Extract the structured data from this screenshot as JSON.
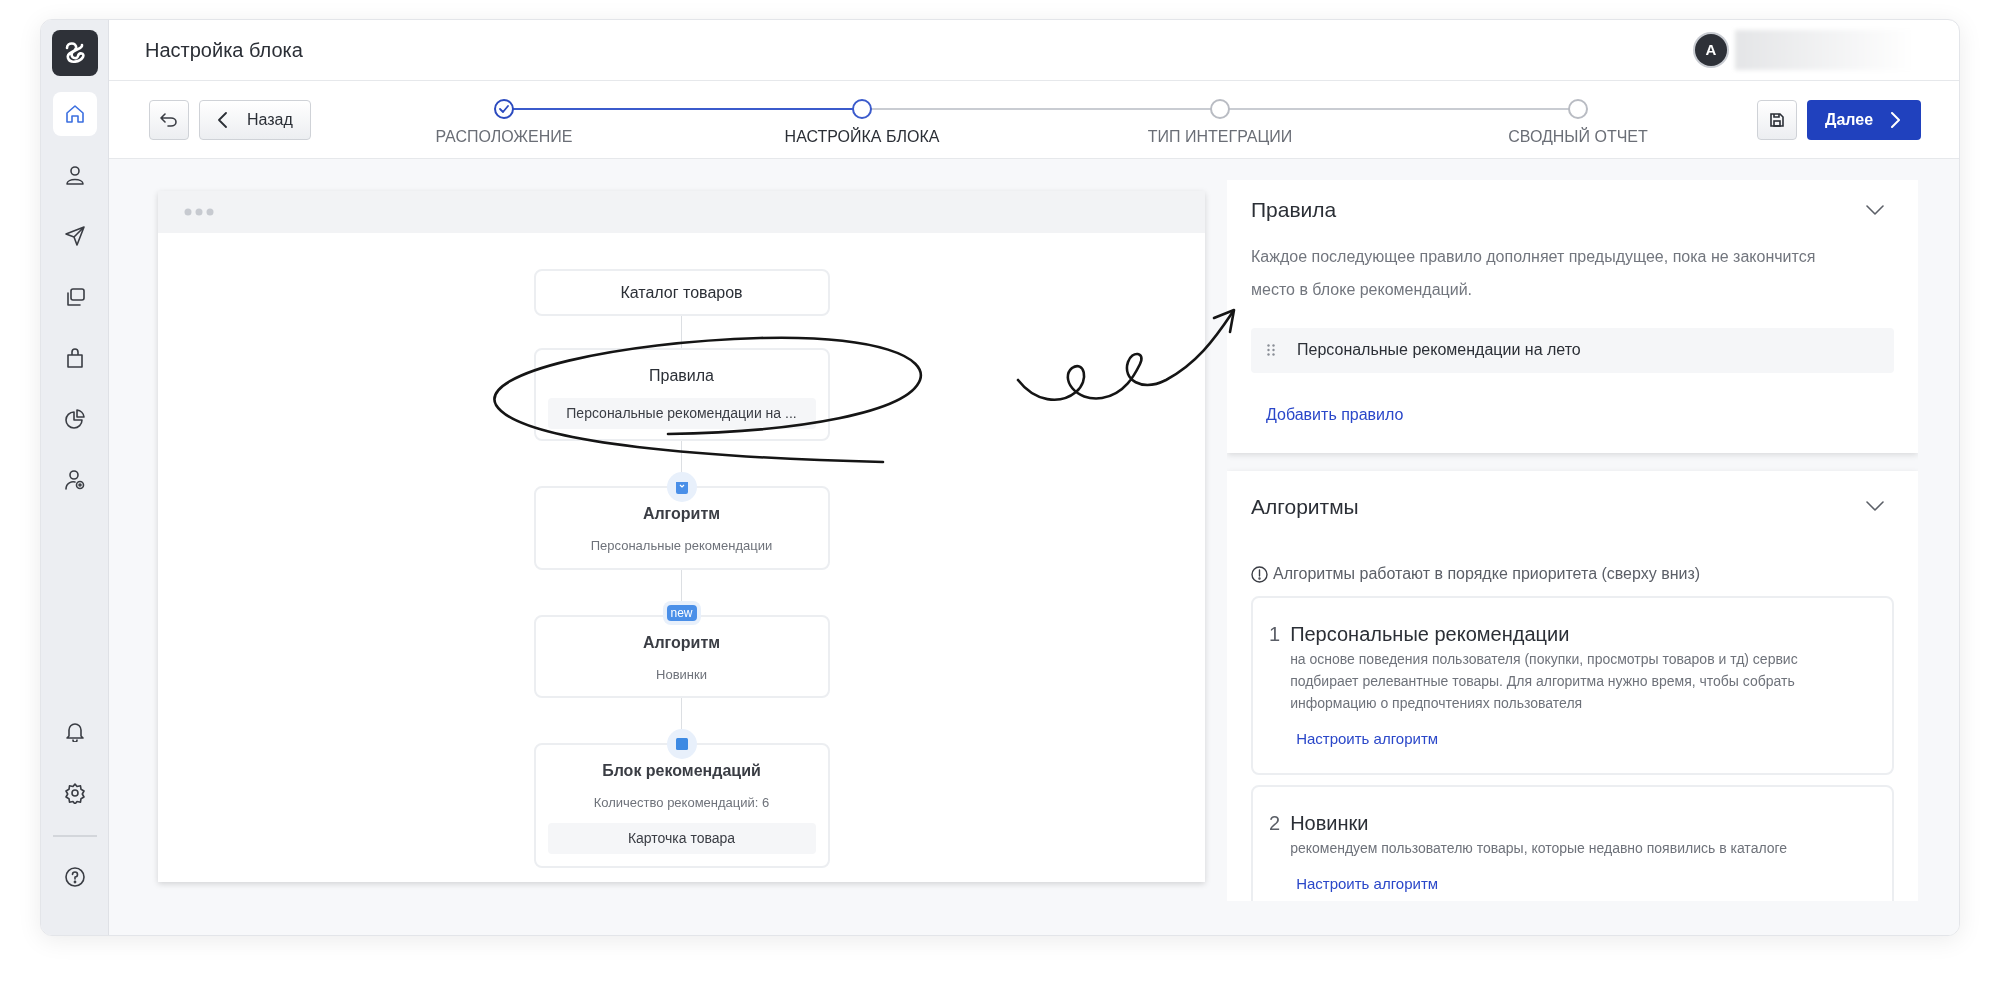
{
  "sidebar": {
    "top_items": [
      {
        "selected": true
      },
      {
        "selected": false
      },
      {
        "selected": false
      },
      {
        "selected": false
      },
      {
        "selected": false
      },
      {
        "selected": false
      },
      {
        "selected": false
      }
    ],
    "bottom_items": [
      {
        "selected": false
      },
      {
        "selected": false
      },
      {
        "selected": false
      }
    ]
  },
  "header": {
    "title": "Настройка блока",
    "avatar": "A"
  },
  "toolbar": {
    "back_label": "Назад",
    "next_label": "Далее"
  },
  "steps": [
    {
      "label": "РАСПОЛОЖЕНИЕ",
      "completed": true,
      "selected": false
    },
    {
      "label": "НАСТРОЙКА БЛОКА",
      "completed": false,
      "selected": true
    },
    {
      "label": "ТИП ИНТЕГРАЦИИ",
      "completed": false,
      "selected": false
    },
    {
      "label": "СВОДНЫЙ ОТЧЕТ",
      "completed": false,
      "selected": false
    }
  ],
  "diagram": {
    "nodes": [
      {
        "kind": "catalog",
        "title": "Каталог товаров"
      },
      {
        "kind": "rules",
        "title": "Правила",
        "chip": "Персональные рекомендации на ..."
      },
      {
        "kind": "algorithm",
        "title": "Алгоритм",
        "subtitle": "Персональные рекомендации"
      },
      {
        "kind": "algorithm",
        "title": "Алгоритм",
        "subtitle": "Новинки",
        "badge": "new"
      },
      {
        "kind": "block",
        "title": "Блок рекомендаций",
        "subtitle": "Количество рекомендаций: 6",
        "chip": "Карточка товара"
      }
    ]
  },
  "rules_panel": {
    "title": "Правила",
    "expanded": true,
    "description": "Каждое последующее правило дополняет предыдущее, пока не закончится место в блоке рекомендаций.",
    "rules": [
      "Персональные рекомендации на лето"
    ],
    "add_link": "Добавить правило"
  },
  "algorithms_panel": {
    "title": "Алгоритмы",
    "expanded": true,
    "note": "Алгоритмы работают в порядке приоритета (сверху вниз)",
    "algorithms": [
      {
        "number": "1",
        "title": "Персональные рекомендации",
        "description": "на основе поведения пользователя (покупки, просмотры товаров и тд) сервис подбирает релевантные товары. Для алгоритма нужно время, чтобы собрать информацию о предпочтениях пользователя",
        "link": "Настроить алгоритм"
      },
      {
        "number": "2",
        "title": "Новинки",
        "description": "рекомендуем пользователю товары, которые недавно появились в каталоге",
        "link": "Настроить алгоритм"
      }
    ]
  }
}
